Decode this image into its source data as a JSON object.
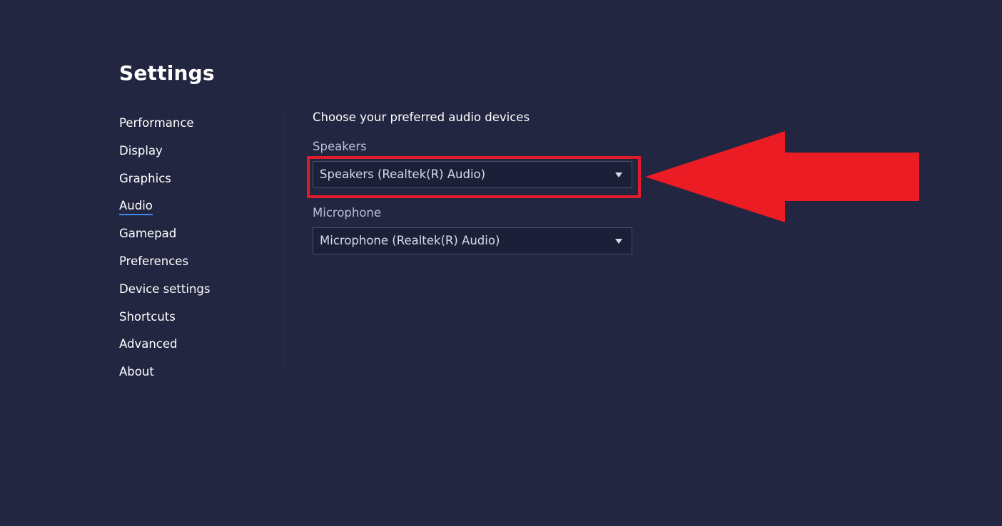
{
  "header": {
    "title": "Settings"
  },
  "sidebar": {
    "items": [
      {
        "label": "Performance"
      },
      {
        "label": "Display"
      },
      {
        "label": "Graphics"
      },
      {
        "label": "Audio",
        "active": true
      },
      {
        "label": "Gamepad"
      },
      {
        "label": "Preferences"
      },
      {
        "label": "Device settings"
      },
      {
        "label": "Shortcuts"
      },
      {
        "label": "Advanced"
      },
      {
        "label": "About"
      }
    ]
  },
  "audio": {
    "heading": "Choose your preferred audio devices",
    "speakers": {
      "label": "Speakers",
      "selected": "Speakers (Realtek(R) Audio)"
    },
    "microphone": {
      "label": "Microphone",
      "selected": "Microphone (Realtek(R) Audio)"
    }
  },
  "icons": {
    "dropdown": "chevron-down-icon",
    "annotation": "arrow-left-icon"
  },
  "colors": {
    "background": "#232640",
    "active_underline": "#3d8cf0",
    "annotation_red": "#e01b2a"
  }
}
